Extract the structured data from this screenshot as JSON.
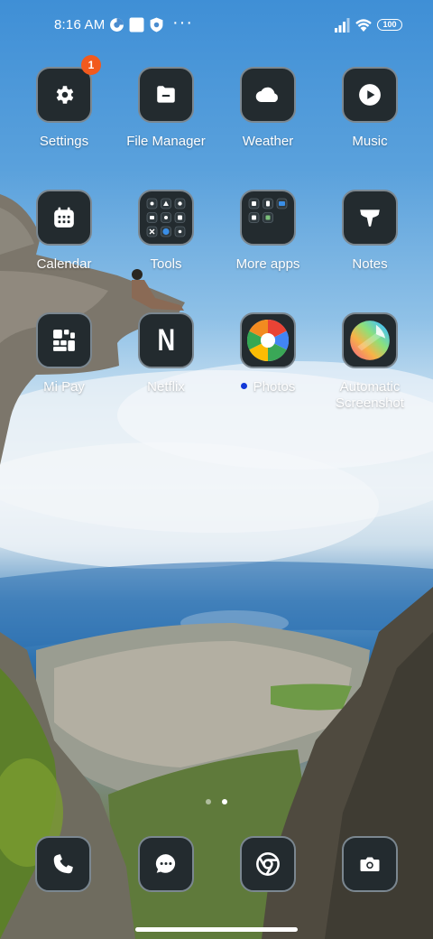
{
  "status_bar": {
    "time": "8:16 AM",
    "left_icons": [
      "data-saver-icon",
      "square-notification-icon",
      "shield-icon"
    ],
    "more": "···",
    "battery": "100"
  },
  "apps": [
    {
      "label": "Settings",
      "icon": "gear-icon",
      "badge": "1"
    },
    {
      "label": "File Manager",
      "icon": "folder-icon"
    },
    {
      "label": "Weather",
      "icon": "cloud-icon"
    },
    {
      "label": "Music",
      "icon": "play-icon"
    },
    {
      "label": "Calendar",
      "icon": "calendar-icon"
    },
    {
      "label": "Tools",
      "icon": "tools-folder-icon"
    },
    {
      "label": "More apps",
      "icon": "apps-folder-icon"
    },
    {
      "label": "Notes",
      "icon": "notes-icon"
    },
    {
      "label": "Mi Pay",
      "icon": "mipay-icon"
    },
    {
      "label": "Netflix",
      "icon": "netflix-icon",
      "glyph": "N"
    },
    {
      "label": "Photos",
      "icon": "photos-icon",
      "new_indicator": true
    },
    {
      "label": "Automatic Screenshot",
      "icon": "screenshot-icon"
    }
  ],
  "pager": {
    "pages": 2,
    "current": 2
  },
  "dock": [
    {
      "name": "phone",
      "icon": "phone-icon"
    },
    {
      "name": "messages",
      "icon": "message-icon"
    },
    {
      "name": "chrome",
      "icon": "chrome-icon"
    },
    {
      "name": "camera",
      "icon": "camera-icon"
    }
  ],
  "colors": {
    "badge": "#f25a1e",
    "tile_bg": "#232b2f",
    "tile_border": "#7b8790",
    "new_dot": "#1238d8"
  }
}
